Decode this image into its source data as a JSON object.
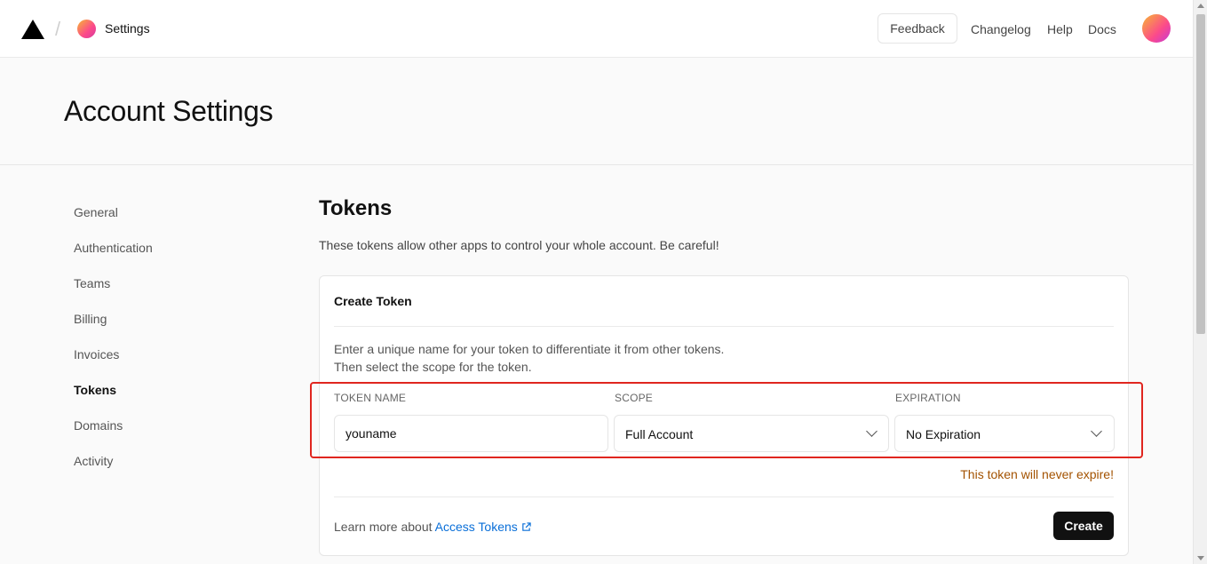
{
  "header": {
    "breadcrumb": "Settings",
    "feedback_label": "Feedback",
    "links": [
      "Changelog",
      "Help",
      "Docs"
    ]
  },
  "page": {
    "title": "Account Settings"
  },
  "sidebar": {
    "items": [
      {
        "label": "General"
      },
      {
        "label": "Authentication"
      },
      {
        "label": "Teams"
      },
      {
        "label": "Billing"
      },
      {
        "label": "Invoices"
      },
      {
        "label": "Tokens",
        "active": true
      },
      {
        "label": "Domains"
      },
      {
        "label": "Activity"
      }
    ]
  },
  "tokens": {
    "title": "Tokens",
    "description": "These tokens allow other apps to control your whole account. Be careful!",
    "card": {
      "title": "Create Token",
      "help_line1": "Enter a unique name for your token to differentiate it from other tokens.",
      "help_line2": "Then select the scope for the token.",
      "token_name_label": "TOKEN NAME",
      "token_name_value": "youname",
      "scope_label": "SCOPE",
      "scope_value": "Full Account",
      "expiration_label": "EXPIRATION",
      "expiration_value": "No Expiration",
      "warning": "This token will never expire!",
      "learn_prefix": "Learn more about ",
      "learn_link": "Access Tokens",
      "create_label": "Create"
    }
  },
  "colors": {
    "accent_link": "#0a6fd8",
    "warning": "#a35200",
    "highlight": "#e0261f",
    "button_bg": "#111111"
  },
  "icons": [
    "triangle-logo-icon",
    "chevron-down-icon",
    "external-link-icon"
  ]
}
